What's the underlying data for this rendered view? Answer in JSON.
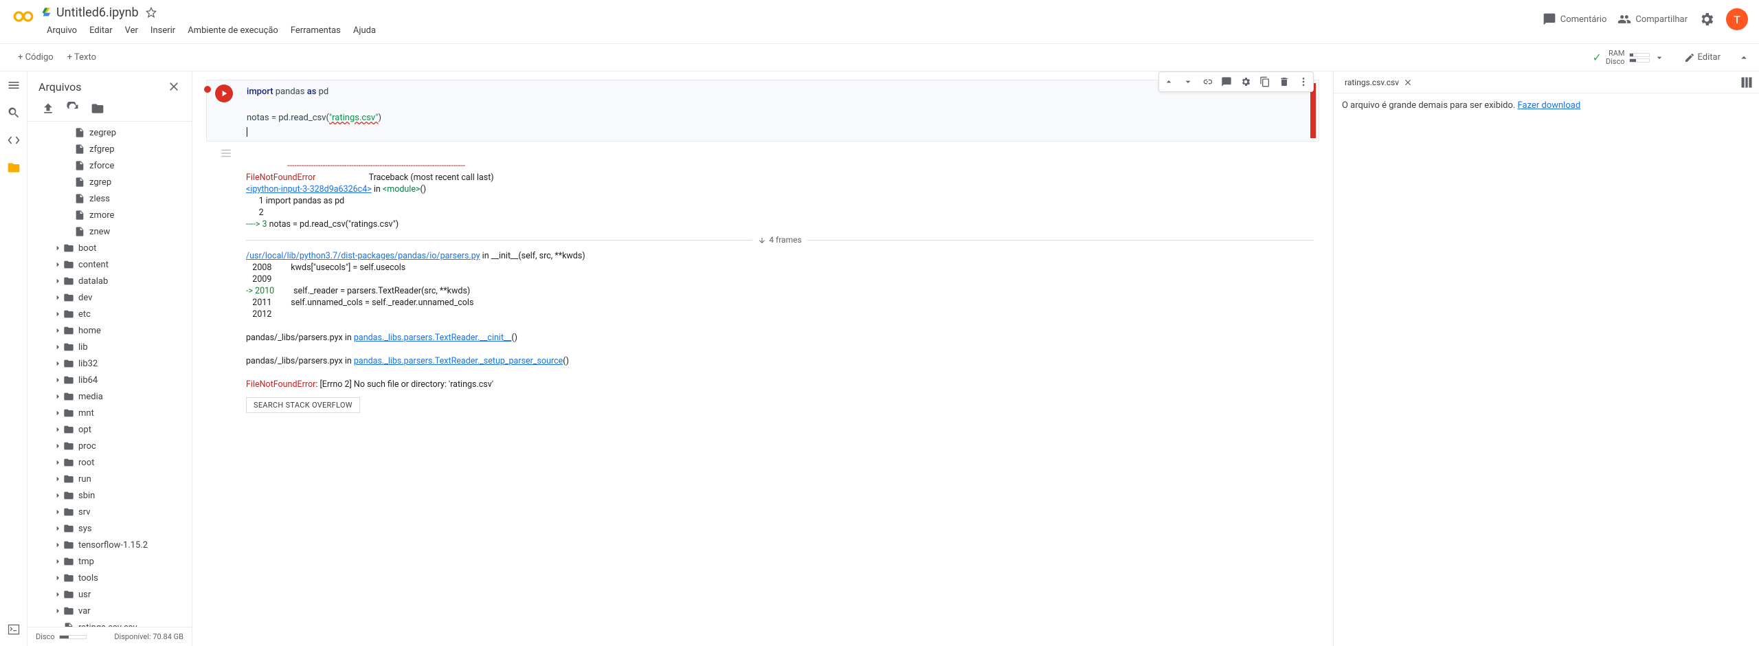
{
  "header": {
    "title": "Untitled6.ipynb",
    "menus": [
      "Arquivo",
      "Editar",
      "Ver",
      "Inserir",
      "Ambiente de execução",
      "Ferramentas",
      "Ajuda"
    ],
    "comment": "Comentário",
    "share": "Compartilhar",
    "avatar": "T"
  },
  "toolbar": {
    "code": "+ Código",
    "text": "+ Texto",
    "ram": "RAM",
    "disk": "Disco",
    "edit": "Editar"
  },
  "files": {
    "title": "Arquivos",
    "tree1": [
      "zegrep",
      "zfgrep",
      "zforce",
      "zgrep",
      "zless",
      "zmore",
      "znew"
    ],
    "folders": [
      "boot",
      "content",
      "datalab",
      "dev",
      "etc",
      "home",
      "lib",
      "lib32",
      "lib64",
      "media",
      "mnt",
      "opt",
      "proc",
      "root",
      "run",
      "sbin",
      "srv",
      "sys",
      "tensorflow-1.15.2",
      "tmp",
      "tools",
      "usr",
      "var"
    ],
    "file": "ratings.csv.csv",
    "disk_label": "Disco",
    "disk_avail": "Disponível: 70.84 GB"
  },
  "code": {
    "l1a": "import",
    "l1b": " pandas ",
    "l1c": "as",
    "l1d": " pd",
    "l3a": "notas = pd.read_csv(",
    "l3b": "\"ratings.csv\"",
    "l3c": ")"
  },
  "output": {
    "dash": "---------------------------------------------------------------------------",
    "err_name": "FileNotFoundError",
    "traceback_lbl": "                         Traceback (most recent call last)",
    "ipy_link": "<ipython-input-3-328d9a6326c4>",
    "in_mod": " in ",
    "module": "<module>",
    "paren": "()",
    "l1": "      1 import pandas as pd",
    "l2": "      2 ",
    "l3_arrow": "----> 3 ",
    "l3_code": "notas = pd.read_csv(\"ratings.csv\")",
    "frames": "4 frames",
    "path1": "/usr/local/lib/python3.7/dist-packages/pandas/io/parsers.py",
    "path1_tail": " in __init__(self, src, **kwds)",
    "p1_2008": "   2008         kwds[\"usecols\"] = self.usecols",
    "p1_2009": "   2009 ",
    "p1_2010a": "-> 2010         ",
    "p1_2010b": "self._reader = parsers.TextReader(src, **kwds)",
    "p1_2011": "   2011         self.unnamed_cols = self._reader.unnamed_cols",
    "p1_2012": "   2012 ",
    "pyx1a": "pandas/_libs/parsers.pyx",
    "pyx1b": " in ",
    "pyx1c": "pandas._libs.parsers.TextReader.__cinit__",
    "pyx1d": "()",
    "pyx2a": "pandas/_libs/parsers.pyx",
    "pyx2b": " in ",
    "pyx2c": "pandas._libs.parsers.TextReader._setup_parser_source",
    "pyx2d": "()",
    "final_a": "FileNotFoundError",
    "final_b": ": [Errno 2] No such file or directory: 'ratings.csv'",
    "so_btn": "SEARCH STACK OVERFLOW"
  },
  "right": {
    "tab": "ratings.csv.csv",
    "msg": "O arquivo é grande demais para ser exibido. ",
    "link": "Fazer download"
  }
}
